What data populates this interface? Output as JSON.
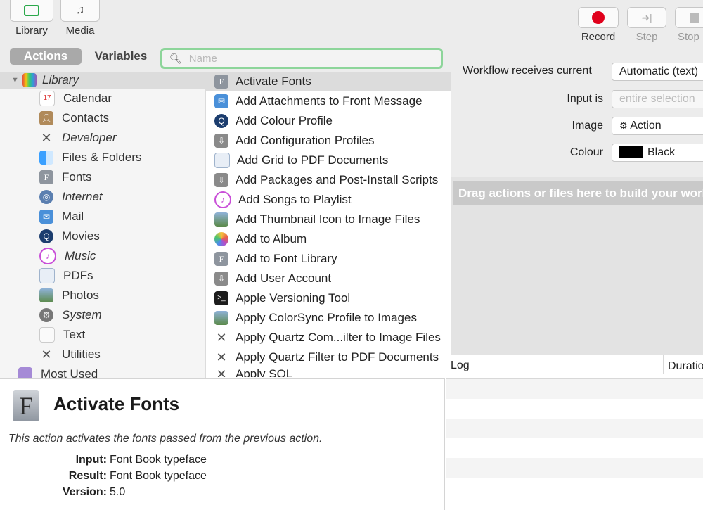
{
  "toolbar": {
    "library": "Library",
    "media": "Media",
    "record": "Record",
    "step": "Step",
    "stop": "Stop"
  },
  "tabs": {
    "actions": "Actions",
    "variables": "Variables"
  },
  "search": {
    "placeholder": "Name"
  },
  "library": {
    "root": "Library",
    "items": [
      {
        "label": "Calendar",
        "icon": "calendar-icon"
      },
      {
        "label": "Contacts",
        "icon": "contacts-icon"
      },
      {
        "label": "Developer",
        "icon": "developer-icon"
      },
      {
        "label": "Files & Folders",
        "icon": "finder-icon"
      },
      {
        "label": "Fonts",
        "icon": "font-book-icon"
      },
      {
        "label": "Internet",
        "icon": "globe-icon"
      },
      {
        "label": "Mail",
        "icon": "mail-icon"
      },
      {
        "label": "Movies",
        "icon": "quicktime-icon"
      },
      {
        "label": "Music",
        "icon": "music-icon"
      },
      {
        "label": "PDFs",
        "icon": "pdf-icon"
      },
      {
        "label": "Photos",
        "icon": "photos-icon"
      },
      {
        "label": "System",
        "icon": "system-icon"
      },
      {
        "label": "Text",
        "icon": "text-icon"
      },
      {
        "label": "Utilities",
        "icon": "utilities-icon"
      },
      {
        "label": "Most Used",
        "icon": "folder-icon"
      }
    ]
  },
  "actions": {
    "items": [
      "Activate Fonts",
      "Add Attachments to Front Message",
      "Add Colour Profile",
      "Add Configuration Profiles",
      "Add Grid to PDF Documents",
      "Add Packages and Post-Install Scripts",
      "Add Songs to Playlist",
      "Add Thumbnail Icon to Image Files",
      "Add to Album",
      "Add to Font Library",
      "Add User Account",
      "Apple Versioning Tool",
      "Apply ColorSync Profile to Images",
      "Apply Quartz Com...ilter to Image Files",
      "Apply Quartz Filter to PDF Documents",
      "Apply SQL"
    ]
  },
  "description": {
    "title": "Activate Fonts",
    "text": "This action activates the fonts passed from the previous action.",
    "input_label": "Input:",
    "input": "Font Book typeface",
    "result_label": "Result:",
    "result": "Font Book typeface",
    "version_label": "Version:",
    "version": "5.0"
  },
  "workflow": {
    "receives_label": "Workflow receives current",
    "receives_value": "Automatic (text)",
    "input_label": "Input is",
    "input_value": "entire selection",
    "image_label": "Image",
    "image_value": "Action",
    "colour_label": "Colour",
    "colour_value": "Black",
    "drop_message": "Drag actions or files here to build your workflow."
  },
  "log": {
    "col_log": "Log",
    "col_duration": "Duration"
  },
  "colors": {
    "record": "#e0001b",
    "search_focus": "#8dd59a"
  }
}
